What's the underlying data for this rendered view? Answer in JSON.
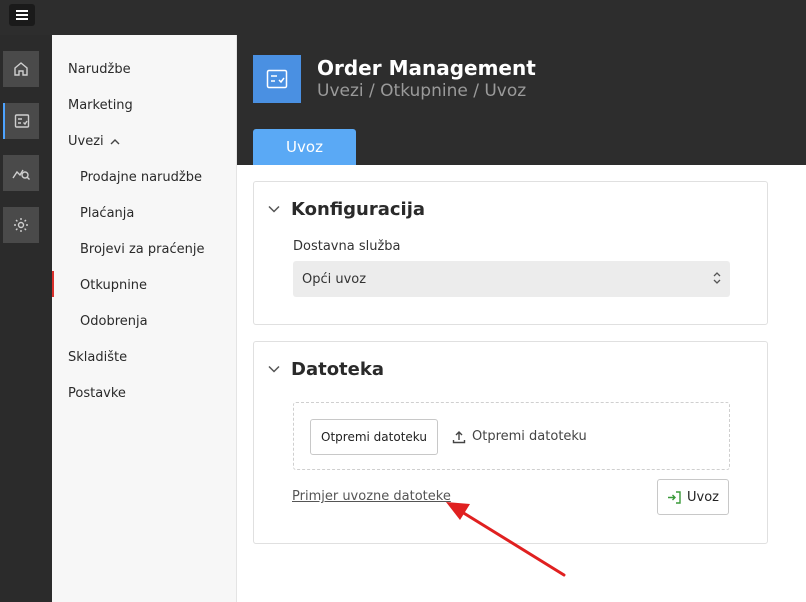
{
  "topbar": {
    "menu_icon": "hamburger-icon"
  },
  "rail": {
    "items": [
      {
        "icon": "home-icon"
      },
      {
        "icon": "checklist-icon"
      },
      {
        "icon": "analytics-search-icon"
      },
      {
        "icon": "settings-gear-icon"
      }
    ]
  },
  "sidebar": {
    "items": [
      {
        "label": "Narudžbe"
      },
      {
        "label": "Marketing"
      },
      {
        "label": "Uvezi"
      },
      {
        "label": "Prodajne narudžbe"
      },
      {
        "label": "Plaćanja"
      },
      {
        "label": "Brojevi za praćenje"
      },
      {
        "label": "Otkupnine"
      },
      {
        "label": "Odobrenja"
      },
      {
        "label": "Skladište"
      },
      {
        "label": "Postavke"
      }
    ],
    "active": "Otkupnine"
  },
  "header": {
    "title": "Order Management",
    "breadcrumb": "Uvezi / Otkupnine / Uvoz",
    "tab_label": "Uvoz"
  },
  "config": {
    "title": "Konfiguracija",
    "field_label": "Dostavna služba",
    "field_value": "Opći uvoz"
  },
  "file": {
    "title": "Datoteka",
    "upload_button": "Otpremi datoteku",
    "upload_hint": "Otpremi datoteku",
    "sample_link": "Primjer uvozne datoteke",
    "import_button": "Uvoz"
  },
  "colors": {
    "accent": "#5aa9f5",
    "annotation": "#e02020"
  }
}
